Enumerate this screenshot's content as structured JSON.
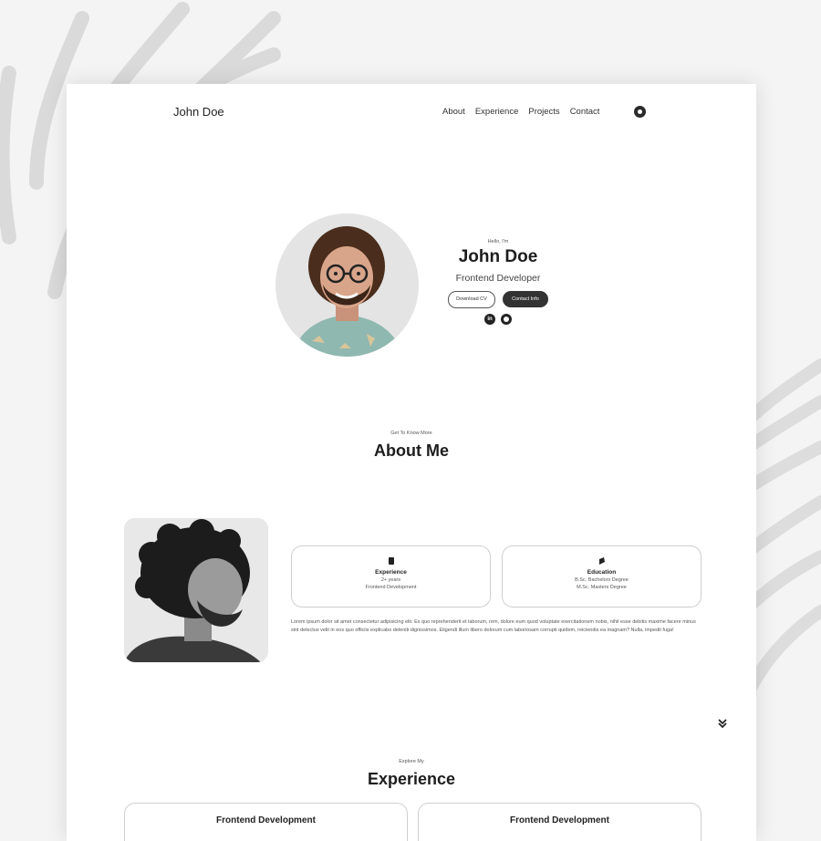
{
  "nav": {
    "brand": "John Doe",
    "links": [
      "About",
      "Experience",
      "Projects",
      "Contact"
    ],
    "theme_icon": "theme-toggle-icon"
  },
  "hero": {
    "greeting": "Hello, I'm",
    "name": "John Doe",
    "role": "Frontend Developer",
    "cv_button": "Download CV",
    "contact_button": "Contact Info",
    "socials": [
      "linkedin-icon",
      "github-icon"
    ]
  },
  "about": {
    "subtitle": "Get To Know More",
    "title": "About Me",
    "cards": [
      {
        "icon": "experience-icon",
        "title": "Experience",
        "lines": [
          "2+ years",
          "Frontend Development"
        ]
      },
      {
        "icon": "education-icon",
        "title": "Education",
        "lines": [
          "B.Sc. Bachelors Degree",
          "M.Sc. Masters Degree"
        ]
      }
    ],
    "text": "Lorem ipsum dolor sit amet consectetur adipisicing elit. Ex quo reprehenderit et laborum, rem, dolore eum quod voluptate exercitationem nobis, nihil esse debitis maxime facere minus sint delectus velit in eos quo officiis explicabo deleniti dignissimos. Eligendi illum libero dolorum cum laboriosam corrupti quidem, reiciendis ea magnam? Nulla, impedit fuga!"
  },
  "experience": {
    "subtitle": "Explore My",
    "title": "Experience",
    "cards": [
      "Frontend Development",
      "Frontend Development"
    ]
  },
  "colors": {
    "page_bg": "#ffffff",
    "outer_bg": "#f4f4f4",
    "dark": "#333333",
    "text": "#222222"
  }
}
